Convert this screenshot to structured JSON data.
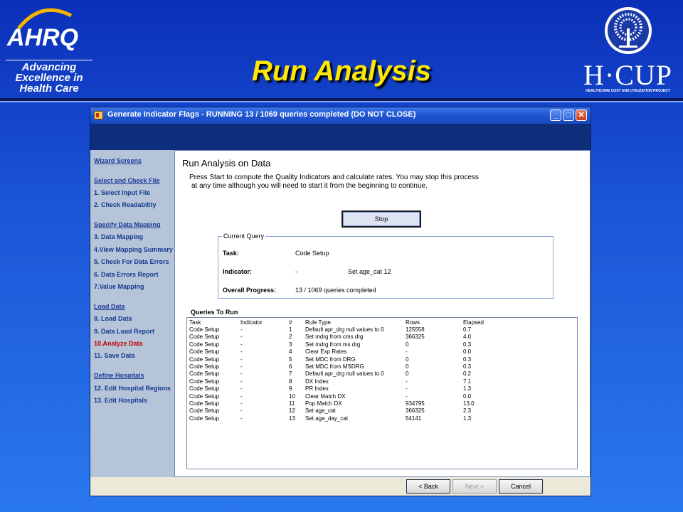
{
  "slide": {
    "title": "Run Analysis",
    "ahrq_logo": "AHRQ",
    "ahrq_tagline_1": "Advancing",
    "ahrq_tagline_2": "Excellence in",
    "ahrq_tagline_3": "Health Care",
    "hcup_word": "H·CUP",
    "hcup_subtitle": "HEALTHCARE COST AND UTILIZATION PROJECT"
  },
  "window": {
    "title": "Generate Indicator Flags - RUNNING 13 / 1069 queries completed  (DO NOT CLOSE)",
    "min_glyph": "_",
    "max_glyph": "□",
    "close_glyph": "✕"
  },
  "wizard": [
    {
      "label": "Wizard Screens",
      "kind": "head"
    },
    {
      "label": "Select and Check File",
      "kind": "head"
    },
    {
      "label": "1. Select Input File",
      "kind": "item"
    },
    {
      "label": "2. Check Readability",
      "kind": "item"
    },
    {
      "label": "Specify Data Mapping",
      "kind": "head"
    },
    {
      "label": "3. Data Mapping",
      "kind": "item"
    },
    {
      "label": "4.View Mapping Summary",
      "kind": "item"
    },
    {
      "label": "5. Check For Data Errors",
      "kind": "item"
    },
    {
      "label": "6. Data Errors Report",
      "kind": "item"
    },
    {
      "label": "7.Value Mapping",
      "kind": "item"
    },
    {
      "label": "Load Data",
      "kind": "head"
    },
    {
      "label": "8. Load Data",
      "kind": "item"
    },
    {
      "label": "9. Data Load Report",
      "kind": "item"
    },
    {
      "label": "10.Analyze Data",
      "kind": "active"
    },
    {
      "label": "11. Save Data",
      "kind": "item"
    },
    {
      "label": "Define Hospitals",
      "kind": "head"
    },
    {
      "label": "12. Edit Hospital Regions",
      "kind": "item"
    },
    {
      "label": "13. Edit Hospitals",
      "kind": "item"
    }
  ],
  "content": {
    "title": "Run Analysis on Data",
    "desc_1": "Press Start to compute the Quality Indicators and calculate rates. You may stop this process",
    "desc_2": "at any time although you will need to start it from the beginning to continue.",
    "stop_label": "Stop",
    "current_query": {
      "legend": "Current Query",
      "task_label": "Task:",
      "task_value": "Code Setup",
      "indicator_label": "Indicator:",
      "indicator_value": "-",
      "indicator_rule": "Set age_cat 12",
      "progress_label": "Overall Progress:",
      "progress_value": "13 / 1069 queries completed"
    },
    "queries_label": "Queries To Run",
    "columns": [
      "Task",
      "Indicator",
      "#",
      "Rule Type",
      "Rows",
      "Elapsed"
    ],
    "rows": [
      [
        "Code Setup",
        "-",
        "1",
        "Default apr_drg null values to 0",
        "125558",
        "0.7"
      ],
      [
        "Code Setup",
        "-",
        "2",
        "Set mdrg from cms drg",
        "366325",
        "4.0"
      ],
      [
        "Code Setup",
        "-",
        "3",
        "Set mdrg from ms drg",
        "0",
        "0.3"
      ],
      [
        "Code Setup",
        "-",
        "4",
        "Clear Exp Rates",
        "-",
        "0.0"
      ],
      [
        "Code Setup",
        "-",
        "5",
        "Set MDC from DRG",
        "0",
        "0.3"
      ],
      [
        "Code Setup",
        "-",
        "6",
        "Set MDC from MSDRG",
        "0",
        "0.3"
      ],
      [
        "Code Setup",
        "-",
        "7",
        "Default apr_drg null values to 0",
        "0",
        "0.2"
      ],
      [
        "Code Setup",
        "-",
        "8",
        "DX Index",
        "-",
        "7.1"
      ],
      [
        "Code Setup",
        "-",
        "9",
        "PR Index",
        "-",
        "1.3"
      ],
      [
        "Code Setup",
        "-",
        "10",
        "Clear Match DX",
        "-",
        "0.0"
      ],
      [
        "Code Setup",
        "-",
        "11",
        "Pop Match DX",
        "934795",
        "13.0"
      ],
      [
        "Code Setup",
        "-",
        "12",
        "Set age_cat",
        "366325",
        "2.3"
      ],
      [
        "Code Setup",
        "-",
        "13",
        "Set age_day_cat",
        "54141",
        "1.3"
      ]
    ]
  },
  "footer": {
    "back": "< Back",
    "next": "Next >",
    "cancel": "Cancel"
  }
}
